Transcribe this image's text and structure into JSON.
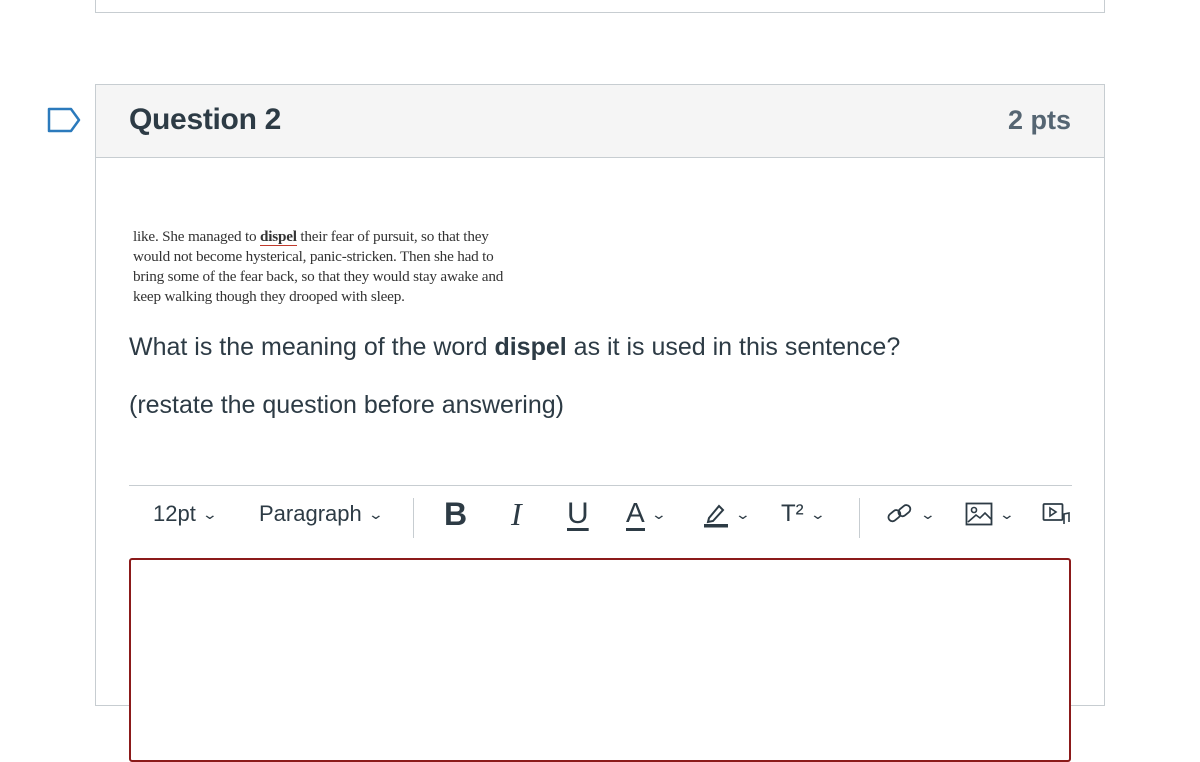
{
  "question": {
    "title": "Question 2",
    "points": "2 pts"
  },
  "passage": {
    "pre": "like. She managed to ",
    "word": "dispel",
    "post_line1": " their fear of pursuit, so that they",
    "line2": "would not become hysterical, panic-stricken. Then she had to",
    "line3": "bring some of the fear back, so that they would stay awake and",
    "line4": "keep walking though they drooped with sleep."
  },
  "prompt": {
    "before": "What is the meaning of the word ",
    "bold": "dispel",
    "after": " as it is used in this sentence?"
  },
  "hint": "(restate the question before answering)",
  "toolbar": {
    "font_size": "12pt",
    "block_format": "Paragraph",
    "bold_label": "B",
    "italic_label": "I",
    "underline_label": "U",
    "text_color_label": "A",
    "superscript_label": "T²",
    "icons": [
      "bold-icon",
      "italic-icon",
      "underline-icon",
      "text-color-icon",
      "highlight-icon",
      "superscript-icon",
      "link-icon",
      "image-icon",
      "media-icon"
    ]
  },
  "colors": {
    "editor_border": "#8b1a1a",
    "flag": "#2b7abc"
  }
}
